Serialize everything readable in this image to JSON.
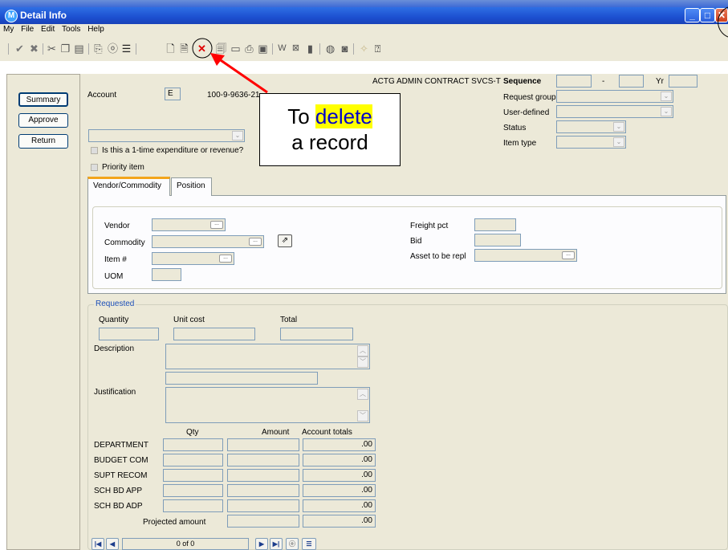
{
  "window": {
    "title": "Detail Info",
    "app_icon": "M"
  },
  "menu": [
    "My",
    "File",
    "Edit",
    "Tools",
    "Help"
  ],
  "toolbar": {
    "icons": [
      "check-icon",
      "cancel-icon",
      "cut-icon",
      "copy-icon",
      "paste-icon",
      "find-replace-icon",
      "binoculars-icon",
      "list-icon",
      "new-record-icon",
      "edit-record-icon",
      "delete-icon",
      "print-preview-icon",
      "document-icon",
      "print-icon",
      "save-icon",
      "word-icon",
      "excel-icon",
      "attachment-icon",
      "globe-icon",
      "camera-icon",
      "wand-icon",
      "help-icon"
    ]
  },
  "sidebar": {
    "summary": "Summary",
    "approve": "Approve",
    "return": "Return"
  },
  "header": {
    "org_text": "ACTG ADMIN CONTRACT SVCS-T",
    "account_label": "Account",
    "account_type": "E",
    "account_number": "100-9-9636-21",
    "sequence_label": "Sequence",
    "sequence_dash": "-",
    "yr_label": "Yr",
    "request_group_label": "Request group",
    "user_defined_label": "User-defined",
    "status_label": "Status",
    "item_type_label": "Item type",
    "one_time_label": "Is this a 1-time expenditure or revenue?",
    "priority_label": "Priority item"
  },
  "tabs": [
    {
      "label": "Vendor/Commodity",
      "active": true
    },
    {
      "label": "Position",
      "active": false
    }
  ],
  "vendor": {
    "vendor_label": "Vendor",
    "commodity_label": "Commodity",
    "item_label": "Item #",
    "uom_label": "UOM",
    "freight_label": "Freight pct",
    "bid_label": "Bid",
    "asset_label": "Asset to be repl",
    "ellipsis": "..."
  },
  "requested": {
    "legend": "Requested",
    "quantity_label": "Quantity",
    "unit_cost_label": "Unit cost",
    "total_label": "Total",
    "description_label": "Description",
    "justification_label": "Justification",
    "col_qty": "Qty",
    "col_amount": "Amount",
    "col_account_totals": "Account totals",
    "rows": [
      {
        "label": "DEPARTMENT",
        "total": ".00"
      },
      {
        "label": "BUDGET COM",
        "total": ".00"
      },
      {
        "label": "SUPT RECOM",
        "total": ".00"
      },
      {
        "label": "SCH BD APP",
        "total": ".00"
      },
      {
        "label": "SCH BD ADP",
        "total": ".00"
      }
    ],
    "projected_label": "Projected amount",
    "projected_total": ".00"
  },
  "navigation": {
    "record_counter": "0 of 0"
  },
  "callout": {
    "line1_prefix": "To ",
    "line1_highlight": "delete",
    "line2": "a record"
  },
  "colors": {
    "titlebar": "#1c4fd0",
    "panel": "#ece9d8",
    "tab_accent": "#f3a51c",
    "arrow": "#ff0000",
    "highlight": "#ffff00",
    "highlight_text": "#0000cc"
  }
}
